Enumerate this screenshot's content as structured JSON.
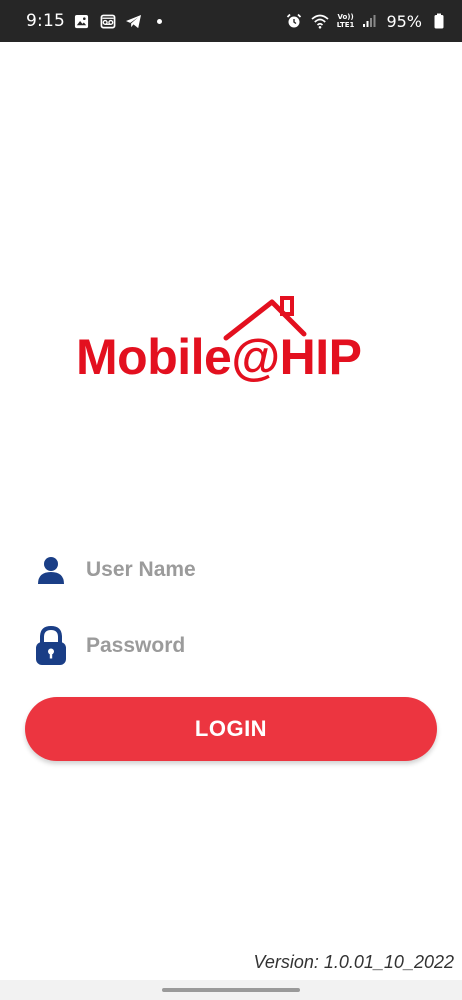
{
  "status_bar": {
    "time": "9:15",
    "network_top": "Vo))",
    "network_bottom": "LTE1",
    "battery_percent": "95%",
    "icons": [
      "gallery-icon",
      "voicemail-icon",
      "telegram-icon",
      "dot-icon",
      "alarm-icon",
      "wifi-icon",
      "signal-icon",
      "battery-icon"
    ]
  },
  "logo": {
    "text": "Mobile@HIP",
    "color": "#e3101f"
  },
  "form": {
    "username_placeholder": "User Name",
    "password_placeholder": "Password",
    "login_label": "LOGIN",
    "icon_color": "#1a3e86"
  },
  "footer": {
    "version": "Version: 1.0.01_10_2022"
  },
  "colors": {
    "accent": "#ec3540",
    "status_bar_bg": "#262626"
  }
}
